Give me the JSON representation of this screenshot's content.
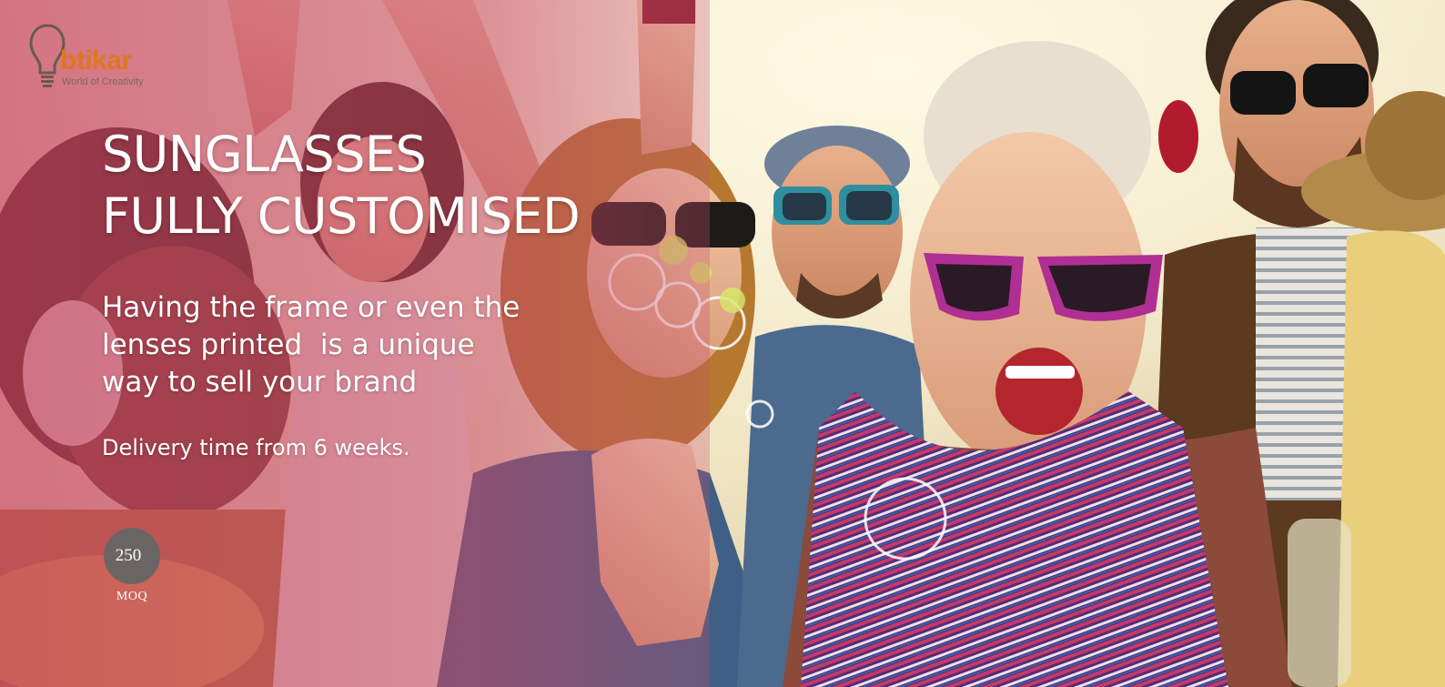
{
  "brand": {
    "wordmark": "btikar",
    "tagline": "World of Creativity",
    "colors": {
      "wordmark": "#e0761f",
      "overlay": "#c44060"
    }
  },
  "hero": {
    "headline_line_1": "SUNGLASSES",
    "headline_line_2": "FULLY CUSTOMISED",
    "body_line_1": "Having the frame or even the",
    "body_line_2": "lenses printed  is a unique",
    "body_line_3": "way to sell your brand",
    "delivery": "Delivery time from 6 weeks."
  },
  "moq": {
    "value": "250",
    "label": "MOQ"
  },
  "icons": {
    "logo": "lightbulb-icon"
  }
}
